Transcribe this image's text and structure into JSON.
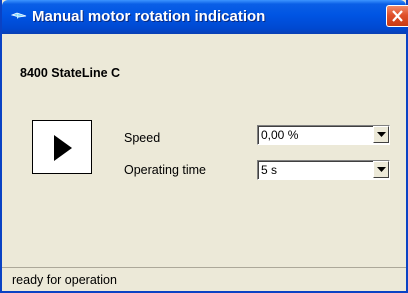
{
  "window": {
    "title": "Manual motor rotation indication"
  },
  "device": {
    "name": "8400 StateLine C"
  },
  "controls": {
    "play_icon": "play-triangle-icon",
    "speed": {
      "label": "Speed",
      "value": "0,00 %"
    },
    "operating_time": {
      "label": "Operating time",
      "value": "5 s"
    }
  },
  "status": {
    "text": "ready for operation"
  },
  "colors": {
    "titlebar": "#0054e3",
    "window_bg": "#ece9d8",
    "close_button": "#e0502a"
  }
}
